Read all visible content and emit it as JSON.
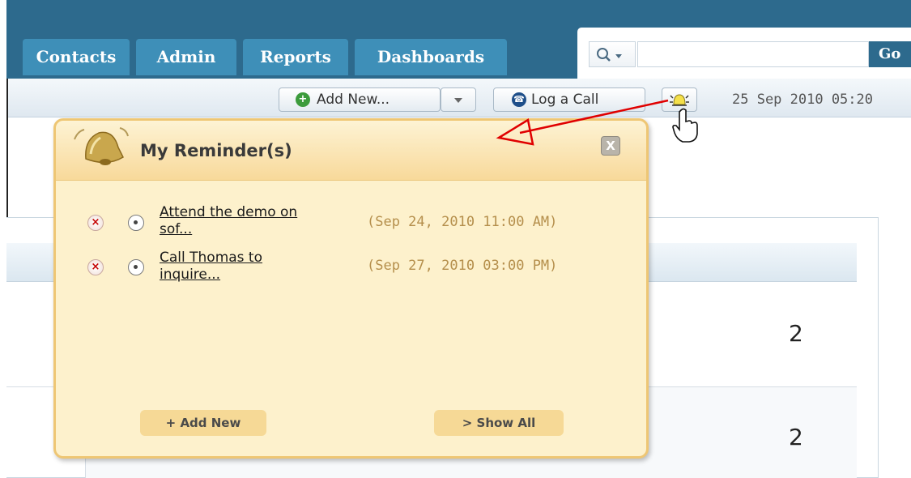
{
  "nav": {
    "tabs": [
      "Contacts",
      "Admin",
      "Reports",
      "Dashboards"
    ],
    "search": {
      "value": "",
      "go_label": "Go"
    }
  },
  "toolbar": {
    "add_new_label": "Add New...",
    "log_call_label": "Log a Call",
    "datetime": "25 Sep 2010 05:20"
  },
  "background": {
    "row_values": [
      "2",
      "2"
    ]
  },
  "reminders": {
    "title": "My Reminder(s)",
    "close_label": "X",
    "items": [
      {
        "line1": "Attend the demo on",
        "line2": "sof...",
        "date": "(Sep 24, 2010 11:00 AM)"
      },
      {
        "line1": "Call Thomas to",
        "line2": "inquire...",
        "date": "(Sep 27, 2010 03:00 PM)"
      }
    ],
    "add_new_label": "+ Add New",
    "show_all_label": "> Show All"
  },
  "colors": {
    "topbar": "#2d6a8d",
    "tab": "#3e8fb8",
    "popup_bg": "#fdf1cc",
    "popup_border": "#eec674",
    "date_text": "#b58f4c",
    "annotation_arrow": "#e00000"
  },
  "icons": [
    "search-icon",
    "plus-icon",
    "phone-icon",
    "dropdown-arrow-icon",
    "bell-icon",
    "reminder-bell-icon",
    "hand-cursor-icon",
    "delete-icon",
    "snooze-icon",
    "close-icon"
  ]
}
